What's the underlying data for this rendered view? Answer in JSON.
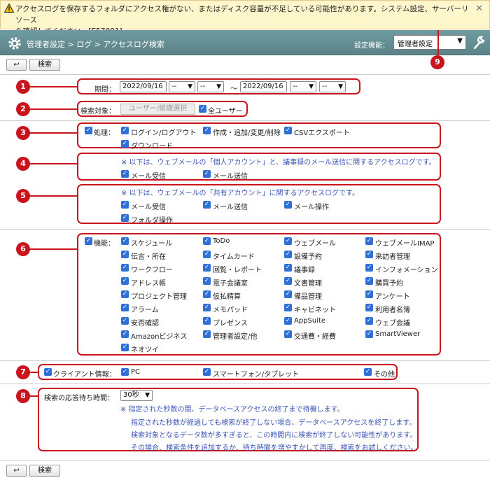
{
  "warning": {
    "line1": "アクセスログを保存するフォルダにアクセス権がない、またはディスク容量が不足している可能性があります。システム設定、サーバーリソース",
    "line2": "を確認してください。[E57001]"
  },
  "header": {
    "breadcrumb": "管理者設定 > ログ > アクセスログ検索",
    "function_label": "設定機能：",
    "function_value": "管理者設定"
  },
  "toolbar": {
    "back": "↩",
    "search": "検索"
  },
  "badges": [
    "1",
    "2",
    "3",
    "4",
    "5",
    "6",
    "7",
    "8",
    "9"
  ],
  "period": {
    "label": "期間：",
    "start_date": "2022/09/16",
    "start_h": "--",
    "start_m": "--",
    "sep": "～",
    "end_date": "2022/09/16",
    "end_h": "--",
    "end_m": "--"
  },
  "target": {
    "label": "検索対象：",
    "select_button": "ユーザー/組織選択",
    "all_users": "全ユーザー"
  },
  "process": {
    "label": "処理：",
    "items": [
      "ログイン/ログアウト",
      "作成・追加/変更/削除",
      "CSVエクスポート",
      "ダウンロード"
    ]
  },
  "personal": {
    "note": "※ 以下は、ウェブメールの「個人アカウント」と、議事録のメール送信に関するアクセスログです。",
    "items": [
      "メール受信",
      "メール送信"
    ]
  },
  "shared": {
    "note": "※ 以下は、ウェブメールの「共有アカウント」に関するアクセスログです。",
    "items": [
      "メール受信",
      "メール送信",
      "メール操作",
      "フォルダ操作"
    ]
  },
  "functions": {
    "label": "機能：",
    "items": [
      "スケジュール",
      "ToDo",
      "ウェブメール",
      "ウェブメールIMAP",
      "伝言・所在",
      "タイムカード",
      "設備予約",
      "来訪者管理",
      "ワークフロー",
      "回覧・レポート",
      "議事録",
      "インフォメーション",
      "アドレス帳",
      "電子会議室",
      "文書管理",
      "購買予約",
      "プロジェクト管理",
      "仮払精算",
      "備品管理",
      "アンケート",
      "アラーム",
      "メモパッド",
      "キャビネット",
      "利用者名簿",
      "安否確認",
      "プレゼンス",
      "AppSuite",
      "ウェブ会議",
      "Amazonビジネス",
      "管理者設定/他",
      "交通費・経費",
      "SmartViewer",
      "ネオツイ"
    ]
  },
  "client": {
    "label": "クライアント情報：",
    "items": [
      "PC",
      "スマートフォン/タブレット",
      "その他"
    ]
  },
  "timeout": {
    "label": "検索の応答待ち時間：",
    "value": "30秒",
    "notes": [
      "※ 指定された秒数の間、データベースアクセスの終了まで待機します。",
      "指定された秒数が経過しても検索が終了しない場合、データベースアクセスを終了します。",
      "検索対象となるデータ数が多すぎると、この時間内に検索が終了しない可能性があります。",
      "その場合、検索条件を追加するか、待ち時間を増やすかして再度、検索をお試しください。"
    ]
  },
  "colors": {
    "accent_red": "#c9141e",
    "header": "#628b90",
    "checkbox": "#2f6fd6",
    "note_blue": "#3a55b8"
  }
}
